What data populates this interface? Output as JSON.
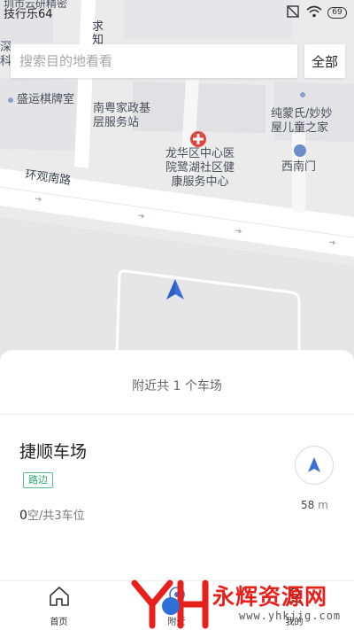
{
  "status_bar": {
    "time": "技行乐64",
    "battery": "69"
  },
  "search": {
    "placeholder": "搜索目的地看看",
    "all_label": "全部"
  },
  "map": {
    "labels": {
      "top_cut": "圳市云研精密",
      "qiu": "求",
      "zhi": "知",
      "shen": "深",
      "ke": "科",
      "chess": "盛运棋牌室",
      "housekeeping": "南粤家政基\n层服务站",
      "kids": "纯蒙氏/妙妙\n屋儿童之家",
      "hospital": "龙华区中心医\n院鹭湖社区健\n康服务中心",
      "west_gate": "西南门",
      "street": "环观南路"
    }
  },
  "sheet": {
    "nearby": "附近共 1 个车场",
    "lot": {
      "name": "捷顺车场",
      "tag": "路边",
      "free": "0",
      "spaces_rest": "空/共3车位",
      "distance": "58",
      "distance_unit": "m"
    }
  },
  "tabs": [
    {
      "label": "首页",
      "icon": "home-icon"
    },
    {
      "label": "附近",
      "icon": "nearby-icon"
    },
    {
      "label": "我的",
      "icon": "profile-icon"
    }
  ],
  "watermark": {
    "brand": "永辉资源网",
    "url": "www.yhkjjg.com"
  },
  "colors": {
    "accent_blue": "#3a6fd8",
    "tag_green": "#2aa96b",
    "poi_red": "#e0463f"
  }
}
